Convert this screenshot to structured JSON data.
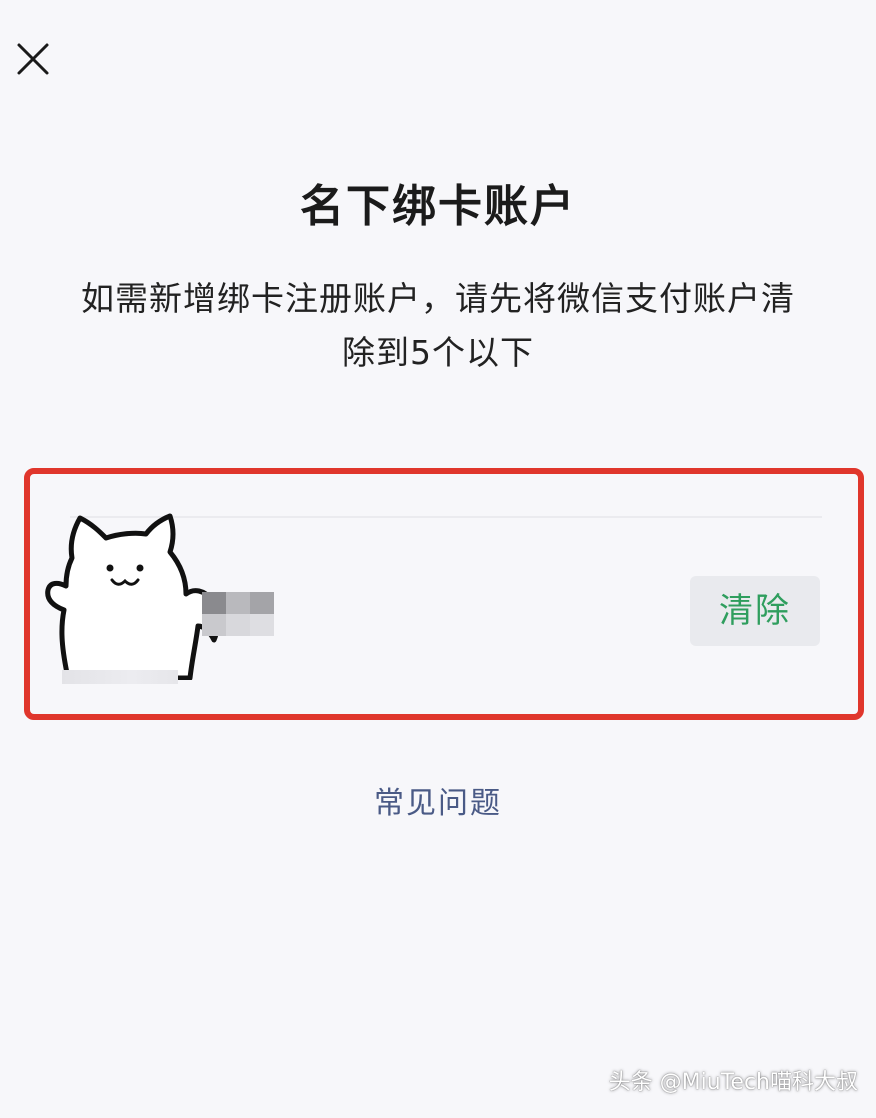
{
  "header": {
    "close_icon": "close-icon"
  },
  "title": "名下绑卡账户",
  "description": "如需新增绑卡注册账户，请先将微信支付账户清除到5个以下",
  "account": {
    "avatar_icon": "cat-avatar-icon",
    "clear_button": "清除",
    "accent_color": "#e0362c",
    "button_text_color": "#2f9e5e"
  },
  "faq_link": "常见问题",
  "watermark": "头条 @MiuTech喵科大叔"
}
